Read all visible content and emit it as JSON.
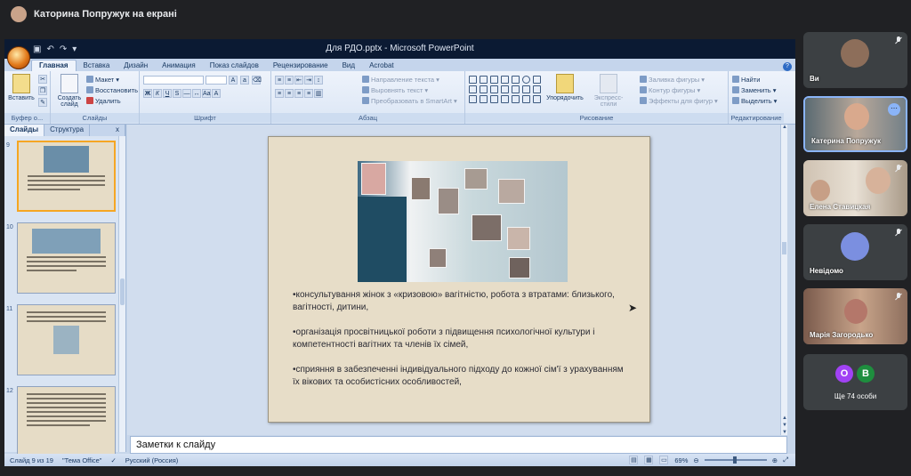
{
  "meet": {
    "presenter_title": "Каторина Попружук на екрані"
  },
  "powerpoint": {
    "window_title": "Для РДО.pptx - Microsoft PowerPoint",
    "tabs": [
      "Главная",
      "Вставка",
      "Дизайн",
      "Анимация",
      "Показ слайдов",
      "Рецензирование",
      "Вид",
      "Acrobat"
    ],
    "active_tab": "Главная",
    "ribbon": {
      "clipboard": {
        "paste": "Вставить",
        "group": "Буфер о..."
      },
      "slides": {
        "new_slide": "Создать слайд",
        "layout": "Макет",
        "reset": "Восстановить",
        "delete": "Удалить",
        "group": "Слайды"
      },
      "font": {
        "group": "Шрифт"
      },
      "paragraph": {
        "text_direction": "Направление текста",
        "align_text": "Выровнять текст",
        "smartart": "Преобразовать в SmartArt",
        "group": "Абзац"
      },
      "drawing": {
        "arrange": "Упорядочить",
        "quick_styles": "Экспресс-стили",
        "shape_fill": "Заливка фигуры",
        "shape_outline": "Контур фигуры",
        "shape_effects": "Эффекты для фигур",
        "group": "Рисование"
      },
      "editing": {
        "find": "Найти",
        "replace": "Заменить",
        "select": "Выделить",
        "group": "Редактирование"
      }
    },
    "left_pane": {
      "tab_slides": "Слайды",
      "tab_outline": "Структура",
      "close": "x",
      "thumbnails": [
        {
          "number": "9"
        },
        {
          "number": "10"
        },
        {
          "number": "11"
        },
        {
          "number": "12"
        }
      ]
    },
    "slide": {
      "bullets": [
        "•консультування жінок з «кризовою» вагітністю, робота з втратами: близького, вагітності, дитини,",
        "•організація просвітницької роботи з підвищення психологічної культури і компетентності вагітних та членів їх сімей,",
        "•сприяння в забезпеченні індивідуального підходу до кожної сім'ї з урахуванням їх вікових та особистісних особливостей,"
      ]
    },
    "notes_placeholder": "Заметки к слайду",
    "status": {
      "slide_info": "Слайд 9 из 19",
      "theme": "\"Тема Office\"",
      "language": "Русский (Россия)",
      "zoom": "69%"
    }
  },
  "participants": [
    {
      "name": "Ви",
      "muted": true
    },
    {
      "name": "Катерина Попружук",
      "active": true
    },
    {
      "name": "Елена Ставицкая",
      "muted": true
    },
    {
      "name": "Невідомо",
      "muted": true
    },
    {
      "name": "Марія Загородько",
      "muted": true
    }
  ],
  "others": {
    "label": "Ще 74 особи",
    "chip1": "О",
    "chip2": "В",
    "chip1_color": "#a142f4",
    "chip2_color": "#1e8e3e"
  }
}
